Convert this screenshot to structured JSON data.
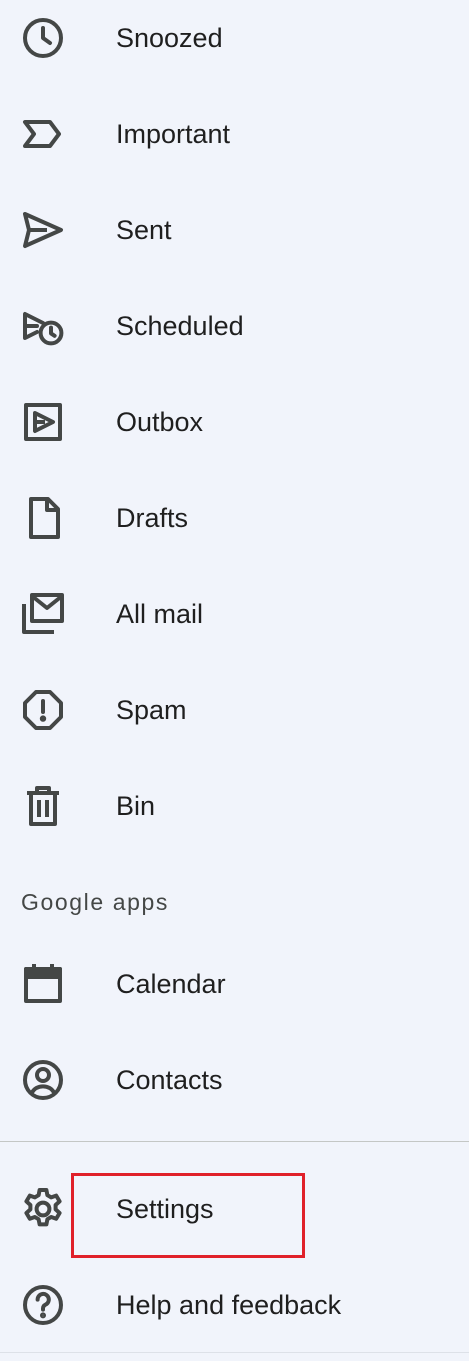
{
  "nav": {
    "items": [
      {
        "label": "Snoozed",
        "icon": "clock-icon"
      },
      {
        "label": "Important",
        "icon": "important-icon"
      },
      {
        "label": "Sent",
        "icon": "send-icon"
      },
      {
        "label": "Scheduled",
        "icon": "scheduled-send-icon"
      },
      {
        "label": "Outbox",
        "icon": "outbox-icon"
      },
      {
        "label": "Drafts",
        "icon": "draft-icon"
      },
      {
        "label": "All mail",
        "icon": "all-mail-icon"
      },
      {
        "label": "Spam",
        "icon": "spam-icon"
      },
      {
        "label": "Bin",
        "icon": "trash-icon"
      }
    ]
  },
  "google_apps": {
    "header": "Google apps",
    "items": [
      {
        "label": "Calendar",
        "icon": "calendar-icon"
      },
      {
        "label": "Contacts",
        "icon": "contacts-icon"
      }
    ]
  },
  "footer": {
    "items": [
      {
        "label": "Settings",
        "icon": "gear-icon"
      },
      {
        "label": "Help and feedback",
        "icon": "help-icon"
      }
    ]
  },
  "colors": {
    "background": "#f1f4fb",
    "icon": "#444746",
    "text": "#1f1f1f",
    "highlight": "#e0202a"
  }
}
